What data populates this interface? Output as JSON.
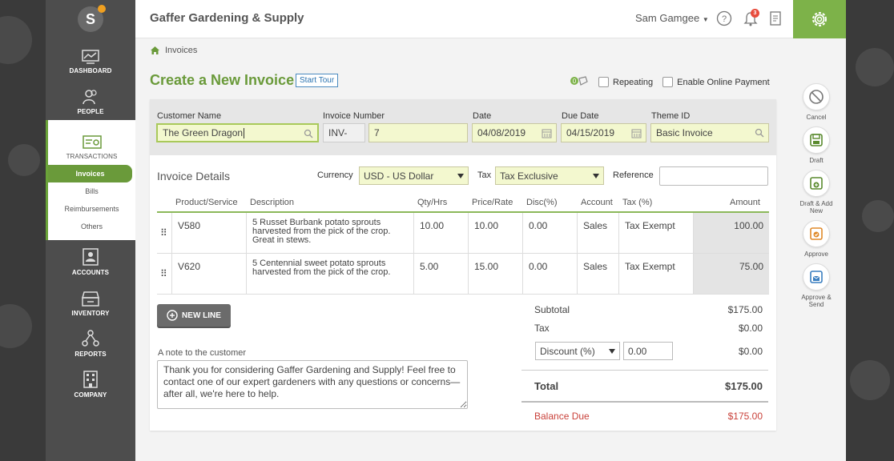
{
  "app": {
    "company_name": "Gaffer Gardening & Supply",
    "user_name": "Sam Gamgee",
    "notification_count": "3",
    "logo_letter": "S"
  },
  "sidebar": {
    "items": [
      {
        "label": "DASHBOARD",
        "icon": "dashboard-icon"
      },
      {
        "label": "PEOPLE",
        "icon": "people-icon"
      },
      {
        "label": "TRANSACTIONS",
        "icon": "transactions-icon"
      },
      {
        "label": "ACCOUNTS",
        "icon": "accounts-icon"
      },
      {
        "label": "INVENTORY",
        "icon": "inventory-icon"
      },
      {
        "label": "REPORTS",
        "icon": "reports-icon"
      },
      {
        "label": "COMPANY",
        "icon": "company-icon"
      }
    ],
    "subitems": [
      "Invoices",
      "Bills",
      "Reimbursements",
      "Others"
    ]
  },
  "breadcrumb": "Invoices",
  "page": {
    "title": "Create a New Invoice",
    "start_tour": "Start Tour",
    "repeating_label": "Repeating",
    "online_payment_label": "Enable Online Payment"
  },
  "header_fields": {
    "customer_label": "Customer Name",
    "customer_value": "The Green Dragon",
    "invoice_number_label": "Invoice Number",
    "invoice_prefix": "INV-",
    "invoice_number": "7",
    "date_label": "Date",
    "date_value": "04/08/2019",
    "due_date_label": "Due Date",
    "due_date_value": "04/15/2019",
    "theme_label": "Theme ID",
    "theme_value": "Basic Invoice"
  },
  "details": {
    "title": "Invoice Details",
    "currency_label": "Currency",
    "currency_value": "USD - US Dollar",
    "tax_label": "Tax",
    "tax_value": "Tax Exclusive",
    "reference_label": "Reference",
    "reference_value": ""
  },
  "table": {
    "columns": [
      "Product/Service",
      "Description",
      "Qty/Hrs",
      "Price/Rate",
      "Disc(%)",
      "Account",
      "Tax (%)",
      "Amount"
    ],
    "rows": [
      {
        "product": "V580",
        "description": "5 Russet Burbank potato sprouts harvested from the pick of the crop. Great in stews.",
        "qty": "10.00",
        "price": "10.00",
        "disc": "0.00",
        "account": "Sales",
        "tax": "Tax Exempt",
        "amount": "100.00"
      },
      {
        "product": "V620",
        "description": "5 Centennial sweet potato sprouts harvested from the pick of the crop.",
        "qty": "5.00",
        "price": "15.00",
        "disc": "0.00",
        "account": "Sales",
        "tax": "Tax Exempt",
        "amount": "75.00"
      }
    ]
  },
  "new_line_label": "NEW LINE",
  "note": {
    "label": "A note to the customer",
    "text": "Thank you for considering Gaffer Gardening and Supply! Feel free to contact one of our expert gardeners with any questions or concerns—after all, we're here to help."
  },
  "totals": {
    "subtotal_label": "Subtotal",
    "subtotal_value": "$175.00",
    "tax_label": "Tax",
    "tax_value": "$0.00",
    "discount_type": "Discount (%)",
    "discount_input": "0.00",
    "discount_value": "$0.00",
    "total_label": "Total",
    "total_value": "$175.00",
    "balance_label": "Balance Due",
    "balance_value": "$175.00"
  },
  "actions": [
    {
      "label": "Cancel"
    },
    {
      "label": "Draft"
    },
    {
      "label": "Draft & Add New"
    },
    {
      "label": "Approve"
    },
    {
      "label": "Approve & Send"
    }
  ],
  "colors": {
    "brand_green": "#6a9a3a",
    "accent_green": "#7db249",
    "input_fill": "#f3f8cf",
    "balance_red": "#c9413a",
    "sidebar_dark": "#4d4d4d"
  }
}
